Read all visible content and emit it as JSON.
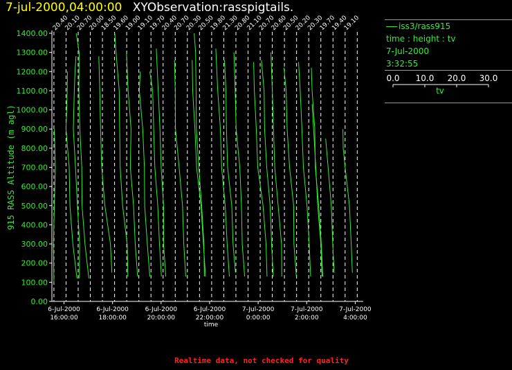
{
  "header": {
    "date_time": "7-jul-2000,04:00:00",
    "observation": "XYObservation:rasspigtails."
  },
  "legend": {
    "series_label": "iss3/rass915",
    "axes_desc": "time : height : tv",
    "date": "7-Jul-2000",
    "time": "3:32:55",
    "scale_ticks": [
      "0.0",
      "10.0",
      "20.0",
      "30.0"
    ],
    "scale_unit": "tv"
  },
  "footer": {
    "quality_note": "Realtime data, not checked for quality"
  },
  "colors": {
    "trace": "#33ee33",
    "axis": "#ffffff",
    "title_date": "#ffff00",
    "warning": "#ff2222"
  },
  "chart_data": {
    "type": "line",
    "xlabel": "time",
    "ylabel": "915 RASS Altitude (m agl)",
    "ylim": [
      0,
      1400
    ],
    "xlim_hours": [
      15.5,
      28.33
    ],
    "y_ticks": [
      "0.00",
      "100.00",
      "200.00",
      "300.00",
      "400.00",
      "500.00",
      "600.00",
      "700.00",
      "800.00",
      "900.00",
      "1000.00",
      "1100.00",
      "1200.00",
      "1300.00",
      "1400.00"
    ],
    "x_ticks": [
      {
        "hour": 16,
        "date": "6-Jul-2000",
        "time": "16:00:00"
      },
      {
        "hour": 18,
        "date": "6-Jul-2000",
        "time": "18:00:00"
      },
      {
        "hour": 20,
        "date": "6-Jul-2000",
        "time": "20:00:00"
      },
      {
        "hour": 22,
        "date": "6-Jul-2000",
        "time": "22:00:00"
      },
      {
        "hour": 24,
        "date": "7-Jul-2000",
        "time": "0:00:00"
      },
      {
        "hour": 26,
        "date": "7-Jul-2000",
        "time": "2:00:00"
      },
      {
        "hour": 28,
        "date": "7-Jul-2000",
        "time": "4:00:00"
      }
    ],
    "profile_times_hours": [
      15.583,
      16.083,
      16.583,
      17.083,
      17.583,
      18.083,
      18.583,
      19.083,
      19.583,
      20.083,
      20.583,
      21.083,
      21.583,
      22.083,
      22.583,
      23.083,
      23.583,
      24.083,
      24.583,
      25.083,
      25.583,
      26.083,
      26.583,
      27.083,
      27.583,
      28.083
    ],
    "baseline_labels": [
      "20.40",
      "20.10",
      "20.70",
      "20.00",
      "18.50",
      "19.60",
      "19.00",
      "19.10",
      "19.70",
      "20.40",
      "20.70",
      "20.30",
      "20.50",
      "19.80",
      "21.30",
      "20.80",
      "21.10",
      "20.70",
      "20.60",
      "20.50",
      "20.20",
      "20.30",
      "19.70",
      "19.40",
      "19.10"
    ],
    "profiles": [
      {
        "t0": 15.583,
        "points": [
          [
            0.0,
            100
          ],
          [
            -0.02,
            300
          ],
          [
            0.02,
            500
          ],
          [
            0.06,
            700
          ],
          [
            0.02,
            900
          ]
        ]
      },
      {
        "t0": 16.083,
        "points": [
          [
            0.45,
            120
          ],
          [
            0.28,
            300
          ],
          [
            0.16,
            500
          ],
          [
            0.13,
            700
          ],
          [
            0.0,
            900
          ],
          [
            0.05,
            1100
          ],
          [
            0.06,
            1200
          ]
        ]
      },
      {
        "t0": 16.583,
        "points": [
          [
            0.05,
            120
          ],
          [
            0.06,
            300
          ],
          [
            -0.03,
            500
          ],
          [
            -0.11,
            700
          ],
          [
            -0.2,
            900
          ],
          [
            -0.16,
            1100
          ],
          [
            -0.13,
            1200
          ],
          [
            -0.09,
            1280
          ]
        ]
      },
      {
        "t0": 17.083,
        "points": [
          [
            -0.06,
            120
          ],
          [
            -0.22,
            300
          ],
          [
            -0.34,
            500
          ],
          [
            -0.35,
            700
          ],
          [
            -0.43,
            900
          ],
          [
            -0.47,
            1100
          ],
          [
            -0.46,
            1300
          ],
          [
            -0.58,
            1400
          ]
        ]
      },
      {
        "t0": 17.583,
        "points": [
          [
            0.39,
            150
          ],
          [
            0.33,
            300
          ],
          [
            0.1,
            500
          ],
          [
            -0.03,
            700
          ],
          [
            -0.08,
            900
          ],
          [
            -0.11,
            1100
          ],
          [
            -0.15,
            1280
          ]
        ]
      },
      {
        "t0": 18.083,
        "points": [
          [
            0.55,
            130
          ],
          [
            0.52,
            300
          ],
          [
            0.33,
            500
          ],
          [
            0.23,
            700
          ],
          [
            0.21,
            900
          ],
          [
            0.19,
            1100
          ],
          [
            0.06,
            1300
          ],
          [
            0.01,
            1400
          ]
        ]
      },
      {
        "t0": 18.583,
        "points": [
          [
            0.45,
            130
          ],
          [
            0.35,
            300
          ],
          [
            0.28,
            500
          ],
          [
            0.15,
            700
          ],
          [
            0.18,
            900
          ],
          [
            0.06,
            1100
          ],
          [
            -0.01,
            1300
          ]
        ]
      },
      {
        "t0": 19.083,
        "points": [
          [
            0.45,
            130
          ],
          [
            0.35,
            300
          ],
          [
            0.24,
            500
          ],
          [
            0.23,
            700
          ],
          [
            0.16,
            900
          ],
          [
            0.02,
            1100
          ],
          [
            0.06,
            1200
          ]
        ]
      },
      {
        "t0": 19.583,
        "points": [
          [
            0.43,
            130
          ],
          [
            0.35,
            300
          ],
          [
            0.28,
            500
          ],
          [
            0.16,
            700
          ],
          [
            0.11,
            900
          ],
          [
            0.07,
            1100
          ],
          [
            -0.05,
            1200
          ]
        ]
      },
      {
        "t0": 20.083,
        "points": [
          [
            0.11,
            130
          ],
          [
            0.02,
            300
          ],
          [
            0.02,
            500
          ],
          [
            -0.08,
            700
          ],
          [
            -0.13,
            900
          ],
          [
            -0.2,
            1100
          ],
          [
            -0.28,
            1320
          ]
        ]
      },
      {
        "t0": 20.583,
        "points": [
          [
            0.43,
            130
          ],
          [
            0.35,
            300
          ],
          [
            0.3,
            500
          ],
          [
            0.16,
            700
          ],
          [
            0.01,
            900
          ],
          [
            0.0,
            1100
          ],
          [
            -0.03,
            1260
          ]
        ]
      },
      {
        "t0": 21.083,
        "points": [
          [
            0.75,
            130
          ],
          [
            0.66,
            300
          ],
          [
            0.56,
            500
          ],
          [
            0.38,
            700
          ],
          [
            0.31,
            900
          ],
          [
            0.22,
            1100
          ],
          [
            0.2,
            1260
          ]
        ]
      },
      {
        "t0": 21.583,
        "points": [
          [
            0.2,
            130
          ],
          [
            0.18,
            300
          ],
          [
            0.09,
            500
          ],
          [
            -0.03,
            700
          ],
          [
            -0.13,
            900
          ],
          [
            -0.14,
            1100
          ],
          [
            -0.16,
            1300
          ],
          [
            -0.22,
            1400
          ]
        ]
      },
      {
        "t0": 22.083,
        "points": [
          [
            0.73,
            130
          ],
          [
            0.64,
            300
          ],
          [
            0.56,
            500
          ],
          [
            0.41,
            700
          ],
          [
            0.36,
            900
          ],
          [
            0.25,
            1100
          ],
          [
            0.17,
            1320
          ]
        ]
      },
      {
        "t0": 22.583,
        "points": [
          [
            0.48,
            150
          ],
          [
            0.38,
            300
          ],
          [
            0.33,
            500
          ],
          [
            0.16,
            700
          ],
          [
            0.11,
            900
          ],
          [
            0.09,
            1100
          ],
          [
            0.03,
            1260
          ]
        ]
      },
      {
        "t0": 23.083,
        "points": [
          [
            0.36,
            130
          ],
          [
            0.26,
            300
          ],
          [
            0.23,
            500
          ],
          [
            0.16,
            700
          ],
          [
            0.01,
            900
          ],
          [
            -0.03,
            1100
          ],
          [
            -0.08,
            1300
          ]
        ]
      },
      {
        "t0": 23.583,
        "points": [
          [
            0.78,
            130
          ],
          [
            0.74,
            300
          ],
          [
            0.62,
            500
          ],
          [
            0.4,
            700
          ],
          [
            0.34,
            900
          ],
          [
            0.26,
            1100
          ],
          [
            0.23,
            1250
          ]
        ]
      },
      {
        "t0": 24.083,
        "points": [
          [
            0.54,
            130
          ],
          [
            0.47,
            300
          ],
          [
            0.41,
            500
          ],
          [
            0.27,
            700
          ],
          [
            0.18,
            900
          ],
          [
            0.16,
            1100
          ],
          [
            0.05,
            1260
          ]
        ]
      },
      {
        "t0": 24.583,
        "points": [
          [
            0.39,
            130
          ],
          [
            0.38,
            300
          ],
          [
            0.24,
            500
          ],
          [
            0.1,
            700
          ],
          [
            0.05,
            900
          ],
          [
            0.0,
            1100
          ],
          [
            -0.06,
            1300
          ]
        ]
      },
      {
        "t0": 25.083,
        "points": [
          [
            0.49,
            130
          ],
          [
            0.39,
            300
          ],
          [
            0.38,
            500
          ],
          [
            0.21,
            700
          ],
          [
            0.11,
            900
          ],
          [
            0.07,
            1100
          ],
          [
            -0.02,
            1220
          ]
        ]
      },
      {
        "t0": 25.583,
        "points": [
          [
            0.58,
            130
          ],
          [
            0.52,
            300
          ],
          [
            0.43,
            500
          ],
          [
            0.28,
            700
          ],
          [
            0.22,
            900
          ],
          [
            0.15,
            1100
          ],
          [
            0.08,
            1250
          ]
        ]
      },
      {
        "t0": 26.083,
        "points": [
          [
            0.58,
            130
          ],
          [
            0.52,
            300
          ],
          [
            0.41,
            500
          ],
          [
            0.27,
            700
          ],
          [
            0.25,
            900
          ],
          [
            0.14,
            1100
          ],
          [
            0.11,
            1220
          ]
        ]
      },
      {
        "t0": 26.583,
        "points": [
          [
            0.05,
            130
          ],
          [
            0.0,
            300
          ],
          [
            -0.13,
            500
          ],
          [
            -0.21,
            700
          ],
          [
            -0.3,
            900
          ],
          [
            -0.36,
            1030
          ]
        ]
      },
      {
        "t0": 27.083,
        "points": [
          [
            0.05,
            150
          ],
          [
            -0.01,
            300
          ],
          [
            -0.07,
            500
          ],
          [
            -0.2,
            700
          ],
          [
            -0.3,
            850
          ]
        ]
      },
      {
        "t0": 27.583,
        "points": [
          [
            0.3,
            150
          ],
          [
            0.25,
            300
          ],
          [
            0.18,
            500
          ],
          [
            0.0,
            700
          ],
          [
            -0.08,
            800
          ],
          [
            -0.09,
            900
          ]
        ]
      }
    ]
  }
}
